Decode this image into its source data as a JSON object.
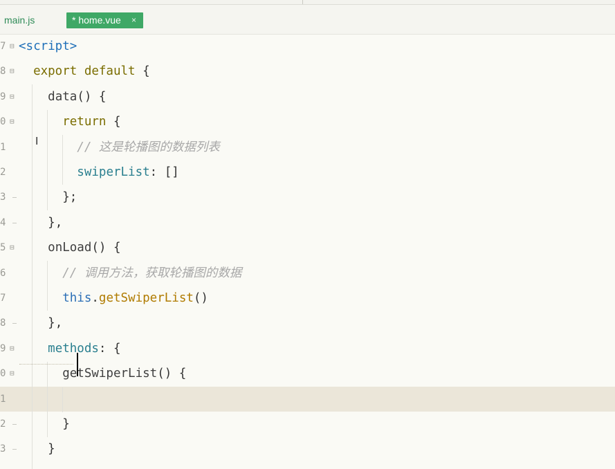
{
  "tabs": [
    {
      "label": "main.js",
      "active": false
    },
    {
      "label": "* home.vue",
      "active": true,
      "close": "×"
    }
  ],
  "colors": {
    "active_tab": "#3fa866",
    "current_line": "#ebe6d9",
    "keyword": "#7a6d00",
    "comment": "#a8a8a8"
  },
  "editor": {
    "lines": [
      {
        "num": "7",
        "fold": "⊟",
        "tokens": [
          {
            "t": "<script>",
            "c": "tag"
          }
        ]
      },
      {
        "num": "8",
        "fold": "⊟",
        "tokens": [
          {
            "t": "  "
          },
          {
            "t": "export default",
            "c": "kw"
          },
          {
            "t": " {",
            "c": "pn"
          }
        ]
      },
      {
        "num": "9",
        "fold": "⊟",
        "tokens": [
          {
            "t": "    "
          },
          {
            "t": "data",
            "c": "fn"
          },
          {
            "t": "() {",
            "c": "pn"
          }
        ]
      },
      {
        "num": "0",
        "fold": "⊟",
        "tokens": [
          {
            "t": "      "
          },
          {
            "t": "return",
            "c": "kw"
          },
          {
            "t": " {",
            "c": "pn"
          }
        ]
      },
      {
        "num": "1",
        "fold": "",
        "tokens": [
          {
            "t": "        "
          },
          {
            "t": "// 这是轮播图的数据列表",
            "c": "cmt"
          }
        ]
      },
      {
        "num": "2",
        "fold": "",
        "tokens": [
          {
            "t": "        "
          },
          {
            "t": "swiperList",
            "c": "prop"
          },
          {
            "t": ": []",
            "c": "pn"
          }
        ]
      },
      {
        "num": "3",
        "fold": "-",
        "tokens": [
          {
            "t": "      "
          },
          {
            "t": "};",
            "c": "pn"
          }
        ]
      },
      {
        "num": "4",
        "fold": "-",
        "tokens": [
          {
            "t": "    "
          },
          {
            "t": "},",
            "c": "pn"
          }
        ]
      },
      {
        "num": "5",
        "fold": "⊟",
        "tokens": [
          {
            "t": "    "
          },
          {
            "t": "onLoad",
            "c": "fn"
          },
          {
            "t": "() {",
            "c": "pn"
          }
        ]
      },
      {
        "num": "6",
        "fold": "",
        "tokens": [
          {
            "t": "      "
          },
          {
            "t": "// 调用方法，获取轮播图的数据",
            "c": "cmt"
          }
        ]
      },
      {
        "num": "7",
        "fold": "",
        "tokens": [
          {
            "t": "      "
          },
          {
            "t": "this",
            "c": "thiskw"
          },
          {
            "t": ".",
            "c": "pn"
          },
          {
            "t": "getSwiperList",
            "c": "call"
          },
          {
            "t": "()",
            "c": "pn"
          }
        ]
      },
      {
        "num": "8",
        "fold": "-",
        "tokens": [
          {
            "t": "    "
          },
          {
            "t": "},",
            "c": "pn"
          }
        ]
      },
      {
        "num": "9",
        "fold": "⊟",
        "tokens": [
          {
            "t": "    "
          },
          {
            "t": "methods",
            "c": "prop"
          },
          {
            "t": ": {",
            "c": "pn"
          }
        ]
      },
      {
        "num": "0",
        "fold": "⊟",
        "tokens": [
          {
            "t": "      "
          },
          {
            "t": "getSwiperList",
            "c": "fn"
          },
          {
            "t": "() {",
            "c": "pn"
          }
        ]
      },
      {
        "num": "1",
        "fold": "",
        "tokens": [],
        "current": true
      },
      {
        "num": "2",
        "fold": "-",
        "tokens": [
          {
            "t": "      "
          },
          {
            "t": "}",
            "c": "pn"
          }
        ]
      },
      {
        "num": "3",
        "fold": "-",
        "tokens": [
          {
            "t": "    "
          },
          {
            "t": "}",
            "c": "pn"
          }
        ]
      }
    ]
  }
}
